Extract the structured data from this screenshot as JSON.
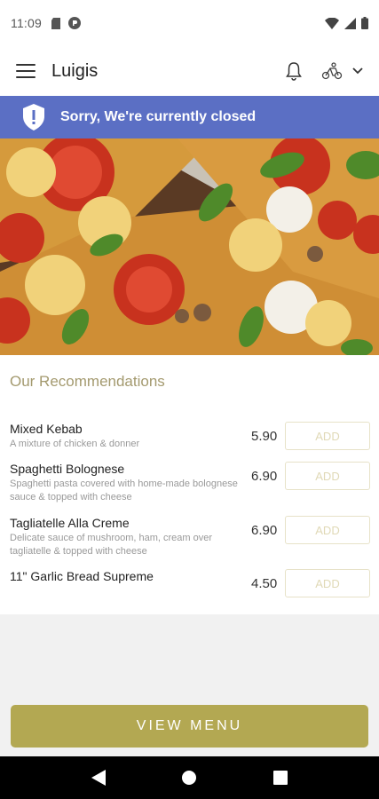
{
  "status_bar": {
    "time": "11:09",
    "icons": [
      "sd-card-icon",
      "app-notification-icon",
      "wifi-icon",
      "signal-icon",
      "battery-icon"
    ]
  },
  "header": {
    "title": "Luigis",
    "icons": [
      "menu-icon",
      "bell-icon",
      "delivery-icon",
      "chevron-down-icon"
    ]
  },
  "banner": {
    "text": "Sorry, We're currently closed",
    "icon": "shield-alert-icon",
    "color": "#5b6fc4"
  },
  "hero": {
    "image": "pizza-photo"
  },
  "recommendations": {
    "title": "Our Recommendations",
    "items": [
      {
        "name": "Mixed Kebab",
        "description": "A mixture of chicken & donner",
        "price": "5.90",
        "add_label": "ADD"
      },
      {
        "name": "Spaghetti Bolognese",
        "description": "Spaghetti pasta covered with home-made bolognese sauce & topped with cheese",
        "price": "6.90",
        "add_label": "ADD"
      },
      {
        "name": "Tagliatelle Alla Creme",
        "description": "Delicate sauce of mushroom, ham, cream over tagliatelle & topped with cheese",
        "price": "6.90",
        "add_label": "ADD"
      },
      {
        "name": "11\" Garlic Bread Supreme",
        "description": "",
        "price": "4.50",
        "add_label": "ADD"
      }
    ]
  },
  "footer": {
    "view_menu_label": "VIEW MENU",
    "accent": "#b3a852"
  },
  "nav_bar": {
    "icons": [
      "back-icon",
      "home-icon",
      "recents-icon"
    ]
  }
}
